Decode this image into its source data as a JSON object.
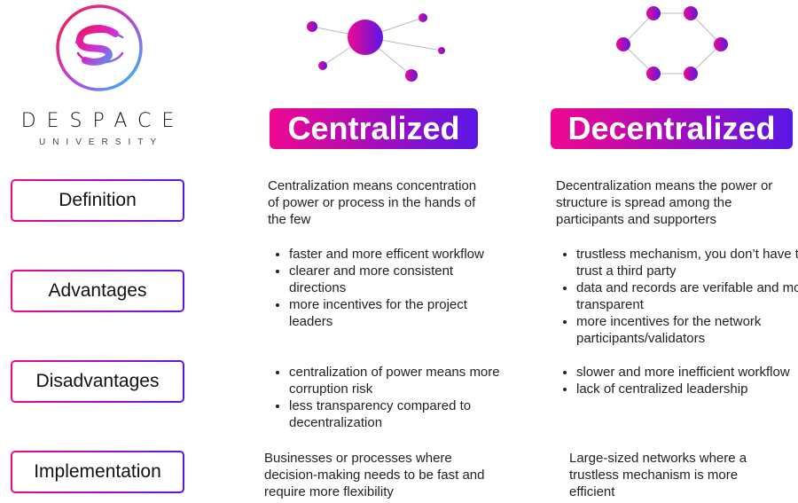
{
  "brand": {
    "name": "DESPACE",
    "subtitle": "UNIVERSITY",
    "logo_icon": "swirl-s-logo-icon"
  },
  "colors": {
    "gradient_start": "#f0078f",
    "gradient_mid": "#a10cc0",
    "gradient_end": "#5a17e6",
    "edge": "#bbbbbb",
    "text": "#222222"
  },
  "columns": [
    {
      "title": "Centralized",
      "icon": "centralized-network-icon"
    },
    {
      "title": "Decentralized",
      "icon": "decentralized-network-icon"
    }
  ],
  "rows": [
    {
      "label": "Definition",
      "centralized": {
        "text": "Centralization means concentration of power or process in the hands of the few"
      },
      "decentralized": {
        "text": "Decentralization  means the power or structure  is spread among the participants and supporters"
      }
    },
    {
      "label": "Advantages",
      "centralized": {
        "items": [
          "faster and more efficent workflow",
          "clearer and more consistent directions",
          "more incentives for the project leaders"
        ]
      },
      "decentralized": {
        "items": [
          "trustless mechanism, you don’t have to trust  a third party",
          "data and records are verifable and more transparent",
          "more incentives for the network participants/validators"
        ]
      }
    },
    {
      "label": "Disadvantages",
      "centralized": {
        "items": [
          "centralization of power means more corruption risk",
          "less transparency compared to decentralization"
        ]
      },
      "decentralized": {
        "items": [
          "slower and more inefficient workflow",
          "lack of centralized leadership"
        ]
      }
    },
    {
      "label": "Implementation",
      "centralized": {
        "text": "Businesses or processes where decision-making needs to be fast and require more flexibility"
      },
      "decentralized": {
        "text": "Large-sized networks where a trustless mechanism is more efficient"
      }
    }
  ]
}
